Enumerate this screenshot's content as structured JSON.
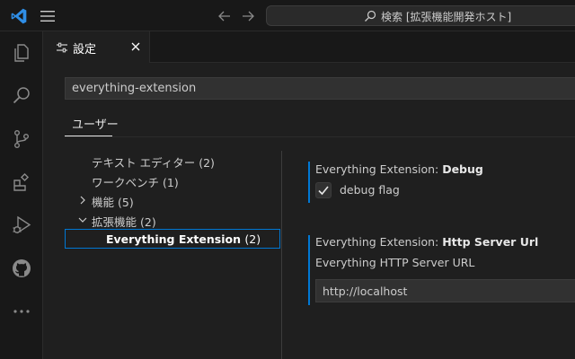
{
  "titlebar": {
    "command_center_text": "検索 [拡張機能開発ホスト]",
    "icons": [
      "vscode-logo",
      "menu-icon",
      "arrow-left-icon",
      "arrow-right-icon",
      "search-icon"
    ]
  },
  "activity_bar": {
    "items": [
      "files-icon",
      "search-icon",
      "source-control-icon",
      "extensions-icon",
      "run-debug-icon",
      "github-icon",
      "more-icon"
    ]
  },
  "tab": {
    "label": "設定",
    "icon": "settings-icon",
    "close_icon": "close-icon"
  },
  "settings": {
    "search_value": "everything-extension",
    "scope_tab": "ユーザー",
    "toc": [
      {
        "label": "テキスト エディター",
        "count": "(2)",
        "expandable": false
      },
      {
        "label": "ワークベンチ",
        "count": "(1)",
        "expandable": false
      },
      {
        "label": "機能",
        "count": "(5)",
        "expandable": true,
        "expanded": false
      },
      {
        "label": "拡張機能",
        "count": "(2)",
        "expandable": true,
        "expanded": true
      },
      {
        "label": "Everything Extension",
        "count": "(2)",
        "selected": true
      }
    ],
    "debug": {
      "category": "Everything Extension: ",
      "name": "Debug",
      "checkbox_label": "debug flag",
      "checked": true
    },
    "http": {
      "category": "Everything Extension: ",
      "name": "Http Server Url",
      "description": "Everything HTTP Server URL",
      "value": "http://localhost"
    }
  },
  "colors": {
    "accent": "#0078d4",
    "background": "#1f1f1f",
    "chrome": "#181818"
  }
}
